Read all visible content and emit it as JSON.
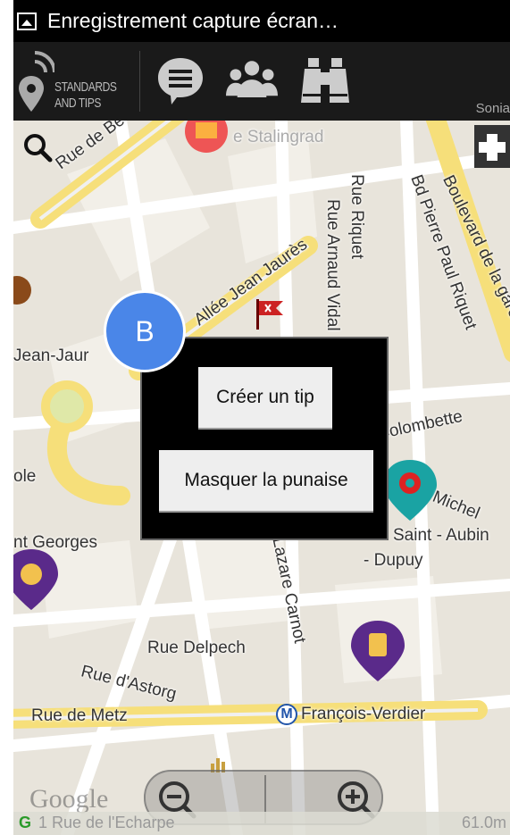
{
  "status_bar": {
    "notification_text": "Enregistrement capture écran…"
  },
  "action_bar": {
    "brand_line1": "STANDARDS",
    "brand_line2": "AND TIPS",
    "user_label": "Sonia"
  },
  "map": {
    "street_labels": {
      "stalingrad": "e Stalingrad",
      "rue_de_be": "Rue de Be",
      "riquet": "Rue Riquet",
      "bd_pierre_paul_riquet": "Bd Pierre Paul Riquet",
      "boulevard_de_la_gare": "Boulevard de la gare",
      "allee_jean_jaures": "Allée Jean Jaurès",
      "rue_arnaud_vidal": "Rue Arnaud Vidal",
      "jean_jaures": "Jean-Jaur",
      "ecole": "ole",
      "la_colombette": "la Colombette",
      "saint_michel": "Michel",
      "saint_georges": "nt Georges",
      "saint_aubin": "Saint - Aubin",
      "dupuy": "- Dupuy",
      "lazare_carnot": "Lazare Carnot",
      "rue_delpech": "Rue Delpech",
      "rue_d_astorg": "Rue d'Astorg",
      "rue_de_metz": "Rue de Metz",
      "francois_verdier": "François-Verdier"
    },
    "metro_letter": "M",
    "google_logo": "Google",
    "address": "1 Rue de l'Echarpe",
    "distance": "61.0m",
    "gps_letter": "G"
  },
  "dialog": {
    "create_tip_label": "Créer un tip",
    "hide_pin_label": "Masquer la punaise"
  },
  "badge": {
    "label": "B"
  }
}
